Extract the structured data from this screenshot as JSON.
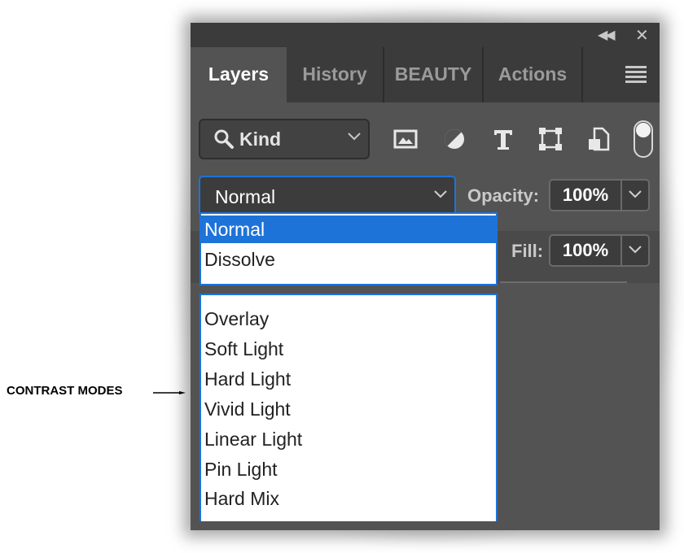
{
  "panel": {
    "tabs": [
      "Layers",
      "History",
      "BEAUTY",
      "Actions"
    ],
    "active_tab": "Layers"
  },
  "filter": {
    "kind_label": "Kind",
    "icons": [
      "image-filter-icon",
      "adjustment-filter-icon",
      "type-filter-icon",
      "shape-filter-icon",
      "smart-object-filter-icon"
    ]
  },
  "blend": {
    "current": "Normal",
    "opacity_label": "Opacity:",
    "opacity_value": "100%",
    "fill_label": "Fill:",
    "fill_value": "100%"
  },
  "dropdown": {
    "group1": [
      "Normal",
      "Dissolve"
    ],
    "group2": [
      "Overlay",
      "Soft Light",
      "Hard Light",
      "Vivid Light",
      "Linear Light",
      "Pin Light",
      "Hard Mix"
    ],
    "selected": "Normal"
  },
  "annotation": {
    "label": "CONTRAST MODES"
  },
  "colors": {
    "accent": "#1e73d9",
    "panel_bg": "#535353",
    "tab_bar": "#3b3b3b"
  }
}
